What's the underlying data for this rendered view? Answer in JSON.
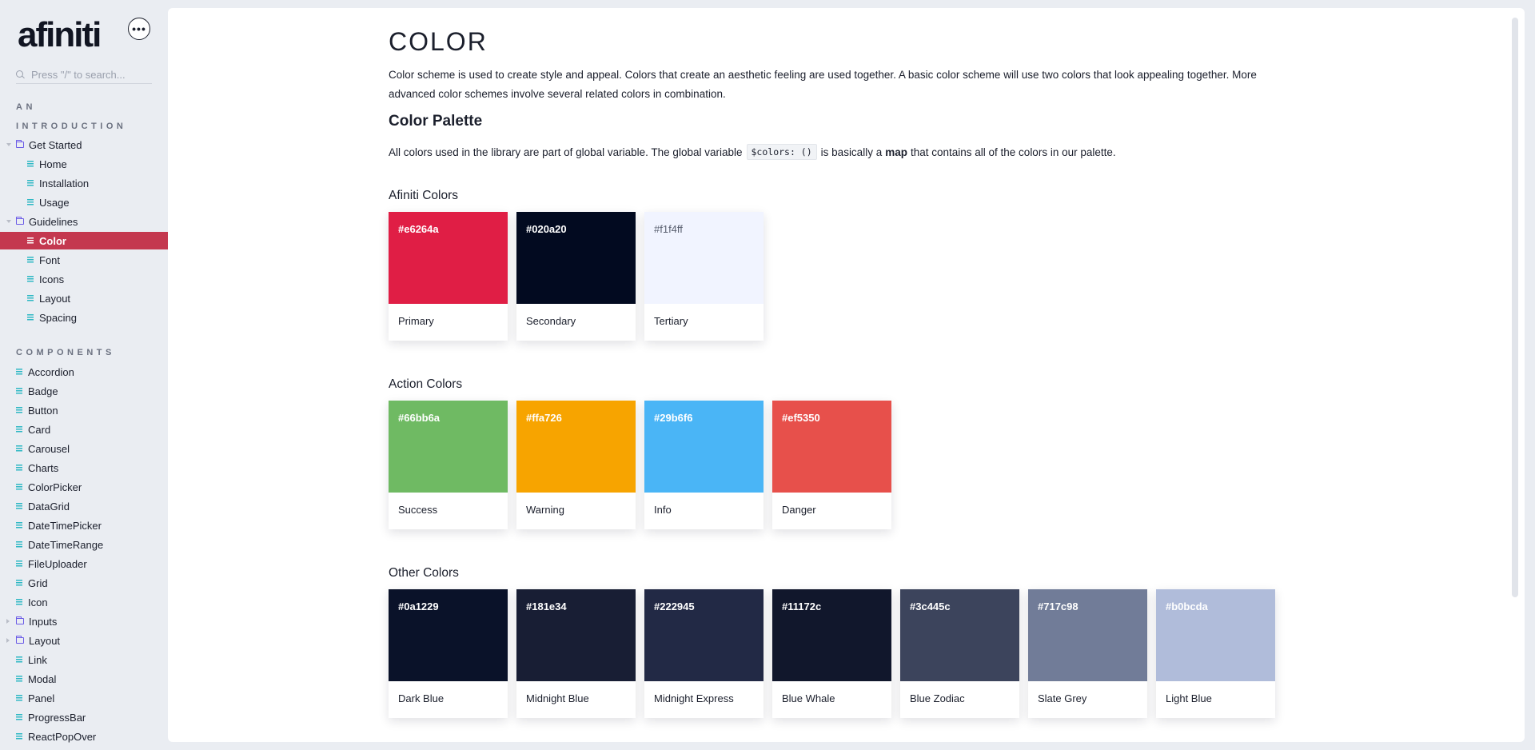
{
  "sidebar": {
    "logo": "afiniti",
    "more_label": "•••",
    "search_placeholder": "Press \"/\" to search...",
    "section_intro_line1": "AN",
    "section_intro_line2": "INTRODUCTION",
    "section_components": "COMPONENTS",
    "intro_items": [
      {
        "label": "Get Started"
      },
      {
        "label": "Home"
      },
      {
        "label": "Installation"
      },
      {
        "label": "Usage"
      },
      {
        "label": "Guidelines"
      },
      {
        "label": "Color"
      },
      {
        "label": "Font"
      },
      {
        "label": "Icons"
      },
      {
        "label": "Layout"
      },
      {
        "label": "Spacing"
      }
    ],
    "components": [
      {
        "label": "Accordion"
      },
      {
        "label": "Badge"
      },
      {
        "label": "Button"
      },
      {
        "label": "Card"
      },
      {
        "label": "Carousel"
      },
      {
        "label": "Charts"
      },
      {
        "label": "ColorPicker"
      },
      {
        "label": "DataGrid"
      },
      {
        "label": "DateTimePicker"
      },
      {
        "label": "DateTimeRange"
      },
      {
        "label": "FileUploader"
      },
      {
        "label": "Grid"
      },
      {
        "label": "Icon"
      },
      {
        "label": "Inputs"
      },
      {
        "label": "Layout"
      },
      {
        "label": "Link"
      },
      {
        "label": "Modal"
      },
      {
        "label": "Panel"
      },
      {
        "label": "ProgressBar"
      },
      {
        "label": "ReactPopOver"
      }
    ]
  },
  "page": {
    "title": "COLOR",
    "intro": "Color scheme is used to create style and appeal. Colors that create an aesthetic feeling are used together. A basic color scheme will use two colors that look appealing together. More advanced color schemes involve several related colors in combination.",
    "palette_heading": "Color Palette",
    "palette_text_1": "All colors used in the library are part of global variable. The global variable",
    "palette_code": "$colors: ()",
    "palette_text_2": "is basically a",
    "palette_bold": "map",
    "palette_text_3": "that contains all of the colors in our palette."
  },
  "groups": [
    {
      "title": "Afiniti Colors",
      "swatches": [
        {
          "hex": "#e6264a",
          "name": "Primary",
          "color": "#e01e45"
        },
        {
          "hex": "#020a20",
          "name": "Secondary",
          "color": "#020a20"
        },
        {
          "hex": "#f1f4ff",
          "name": "Tertiary",
          "color": "#f1f4ff"
        }
      ]
    },
    {
      "title": "Action Colors",
      "swatches": [
        {
          "hex": "#66bb6a",
          "name": "Success",
          "color": "#6fba63"
        },
        {
          "hex": "#ffa726",
          "name": "Warning",
          "color": "#f7a400"
        },
        {
          "hex": "#29b6f6",
          "name": "Info",
          "color": "#4ab5f6"
        },
        {
          "hex": "#ef5350",
          "name": "Danger",
          "color": "#e7504b"
        }
      ]
    },
    {
      "title": "Other Colors",
      "swatches": [
        {
          "hex": "#0a1229",
          "name": "Dark Blue",
          "color": "#0a1229"
        },
        {
          "hex": "#181e34",
          "name": "Midnight Blue",
          "color": "#181e34"
        },
        {
          "hex": "#222945",
          "name": "Midnight Express",
          "color": "#222945"
        },
        {
          "hex": "#11172c",
          "name": "Blue Whale",
          "color": "#11172c"
        },
        {
          "hex": "#3c445c",
          "name": "Blue Zodiac",
          "color": "#3c445c"
        },
        {
          "hex": "#717c98",
          "name": "Slate Grey",
          "color": "#717c98"
        },
        {
          "hex": "#b0bcda",
          "name": "Light Blue",
          "color": "#b0bcda"
        }
      ]
    }
  ]
}
